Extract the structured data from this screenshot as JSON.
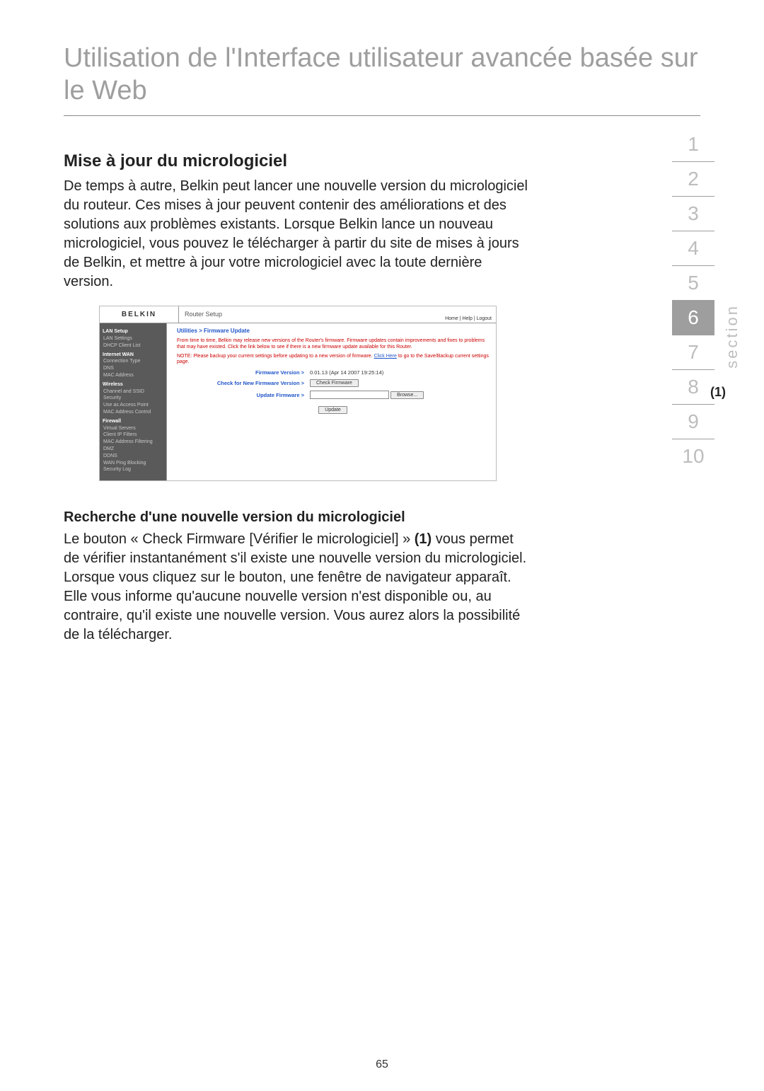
{
  "page_title": "Utilisation de l'Interface utilisateur avancée basée sur le Web",
  "section_heading": "Mise à jour du micrologiciel",
  "intro_paragraph": "De temps à autre, Belkin peut lancer une nouvelle version du micrologiciel du routeur. Ces mises à jour peuvent contenir des améliorations et des solutions aux problèmes existants. Lorsque Belkin lance un nouveau micrologiciel, vous pouvez le télécharger à partir du site de mises à jours de Belkin, et mettre à jour votre micrologiciel avec la toute dernière version.",
  "sub_heading": "Recherche d'une nouvelle version du micrologiciel",
  "body2_a": "Le bouton « Check Firmware [Vérifier le micrologiciel] » ",
  "body2_bold": "(1)",
  "body2_b": " vous permet de vérifier instantanément s'il existe une nouvelle version du micrologiciel. Lorsque vous cliquez sur le bouton, une fenêtre de navigateur apparaît. Elle vous informe qu'aucune nouvelle version n'est disponible ou, au contraire, qu'il existe une nouvelle version. Vous aurez alors la possibilité de la télécharger.",
  "side_nav": [
    "1",
    "2",
    "3",
    "4",
    "5",
    "6",
    "7",
    "8",
    "9",
    "10"
  ],
  "side_nav_active_index": 5,
  "side_label": "section",
  "callout": "(1)",
  "page_number": "65",
  "router": {
    "brand": "BELKIN",
    "setup_title": "Router Setup",
    "top_links": "Home | Help | Logout",
    "breadcrumb": "Utilities > Firmware Update",
    "note1": "From time to time, Belkin may release new versions of the Router's firmware. Firmware updates contain improvements and fixes to problems that may have existed. Click the link below to see if there is a new firmware update available for this Router.",
    "note2_a": "NOTE: Please backup your current settings before updating to a new version of firmware.",
    "note2_link": "Click Here",
    "note2_b": " to go to the Save/Backup current settings page.",
    "row_fw_version_label": "Firmware Version >",
    "row_fw_version_value": "0.01.13 (Apr 14 2007 19:25:14)",
    "row_check_label": "Check for New Firmware Version >",
    "btn_check": "Check Firmware",
    "row_update_label": "Update Firmware >",
    "btn_browse": "Browse...",
    "btn_update": "Update",
    "sidebar": [
      {
        "t": "grp",
        "l": "LAN Setup"
      },
      {
        "t": "itm",
        "l": "LAN Settings"
      },
      {
        "t": "itm",
        "l": "DHCP Client List"
      },
      {
        "t": "grp",
        "l": "Internet WAN"
      },
      {
        "t": "itm",
        "l": "Connection Type"
      },
      {
        "t": "itm",
        "l": "DNS"
      },
      {
        "t": "itm",
        "l": "MAC Address"
      },
      {
        "t": "grp",
        "l": "Wireless"
      },
      {
        "t": "itm",
        "l": "Channel and SSID"
      },
      {
        "t": "itm",
        "l": "Security"
      },
      {
        "t": "itm",
        "l": "Use as Access Point"
      },
      {
        "t": "itm",
        "l": "MAC Address Control"
      },
      {
        "t": "grp",
        "l": "Firewall"
      },
      {
        "t": "itm",
        "l": "Virtual Servers"
      },
      {
        "t": "itm",
        "l": "Client IP Filters"
      },
      {
        "t": "itm",
        "l": "MAC Address Filtering"
      },
      {
        "t": "itm",
        "l": "DMZ"
      },
      {
        "t": "itm",
        "l": "DDNS"
      },
      {
        "t": "itm",
        "l": "WAN Ping Blocking"
      },
      {
        "t": "itm",
        "l": "Security Log"
      }
    ]
  }
}
